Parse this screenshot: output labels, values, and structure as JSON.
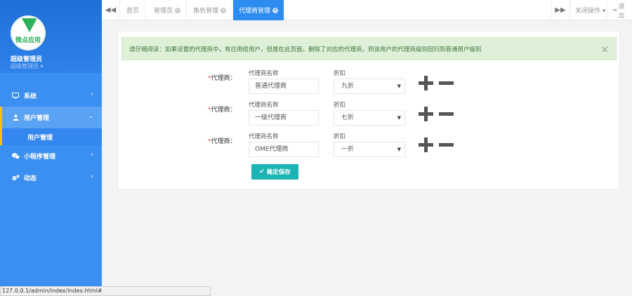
{
  "sidebar": {
    "logo_text": "微点应用",
    "profile_name": "超级管理员",
    "profile_role": "超级管理员 ▾",
    "items": [
      {
        "label": "系统",
        "icon": "monitor-icon"
      },
      {
        "label": "用户管理",
        "icon": "user-icon"
      },
      {
        "label": "小程序管理",
        "icon": "wechat-icon"
      },
      {
        "label": "动态",
        "icon": "gears-icon"
      }
    ],
    "sub_items": [
      {
        "label": "用户管理"
      }
    ]
  },
  "tabs": [
    {
      "label": "首页"
    },
    {
      "label": "管理员"
    },
    {
      "label": "角色管理"
    },
    {
      "label": "代理商管理"
    }
  ],
  "topbar": {
    "close_ops": "关闭操作 ▾",
    "logout": "退出"
  },
  "alert": {
    "text": "请仔细阅读：如果设置的代理商中，有应用给用户，但是在此页面，删除了对应的代理商，则该用户的代理商级别回归到普通用户级别"
  },
  "form": {
    "row_label": "代理商：",
    "name_label": "代理商名称",
    "discount_label": "折扣",
    "rows": [
      {
        "name": "普通代理商",
        "discount": "九折"
      },
      {
        "name": "一级代理商",
        "discount": "七折"
      },
      {
        "name": "OME代理商",
        "discount": "一折"
      }
    ],
    "save_label": "确定保存"
  },
  "statusbar": {
    "url": "127.0.0.1/admin/index/index.html#"
  }
}
